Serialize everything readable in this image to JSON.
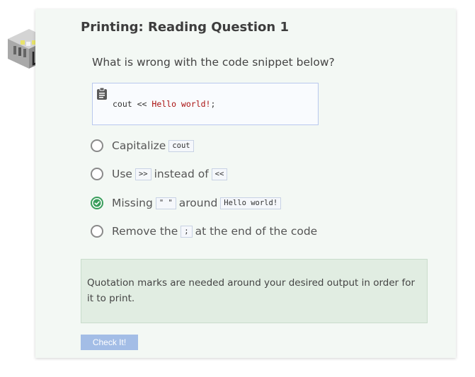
{
  "page": {
    "title": "Printing: Reading Question 1",
    "prompt": "What is wrong with the code snippet below?"
  },
  "code": {
    "prefix": "cout << ",
    "string_part": "Hello world!",
    "suffix": ";"
  },
  "options": [
    {
      "text1": "Capitalize",
      "code1": "cout",
      "text2": "",
      "code2": "",
      "text3": "",
      "checked": false
    },
    {
      "text1": "Use",
      "code1": ">>",
      "text2": "instead of",
      "code2": "<<",
      "text3": "",
      "checked": false
    },
    {
      "text1": "Missing",
      "code1": "\" \"",
      "text2": "around",
      "code2": "Hello world!",
      "text3": "",
      "checked": true
    },
    {
      "text1": "Remove the",
      "code1": ";",
      "text2": "at the end of the code",
      "code2": "",
      "text3": "",
      "checked": false
    }
  ],
  "feedback": {
    "text": "Quotation marks are needed around your desired output in order for it to print."
  },
  "button": {
    "label": "Check It!"
  },
  "colors": {
    "card_bg": "#f3f8f4",
    "feedback_bg": "#e1ede2",
    "button_bg": "#a3bde6",
    "checked_radio": "#3a9e5c",
    "code_string": "#aa1111"
  },
  "icons": {
    "logo": "codio-logo-icon",
    "clipboard": "clipboard-icon",
    "check": "check-circle-icon"
  }
}
